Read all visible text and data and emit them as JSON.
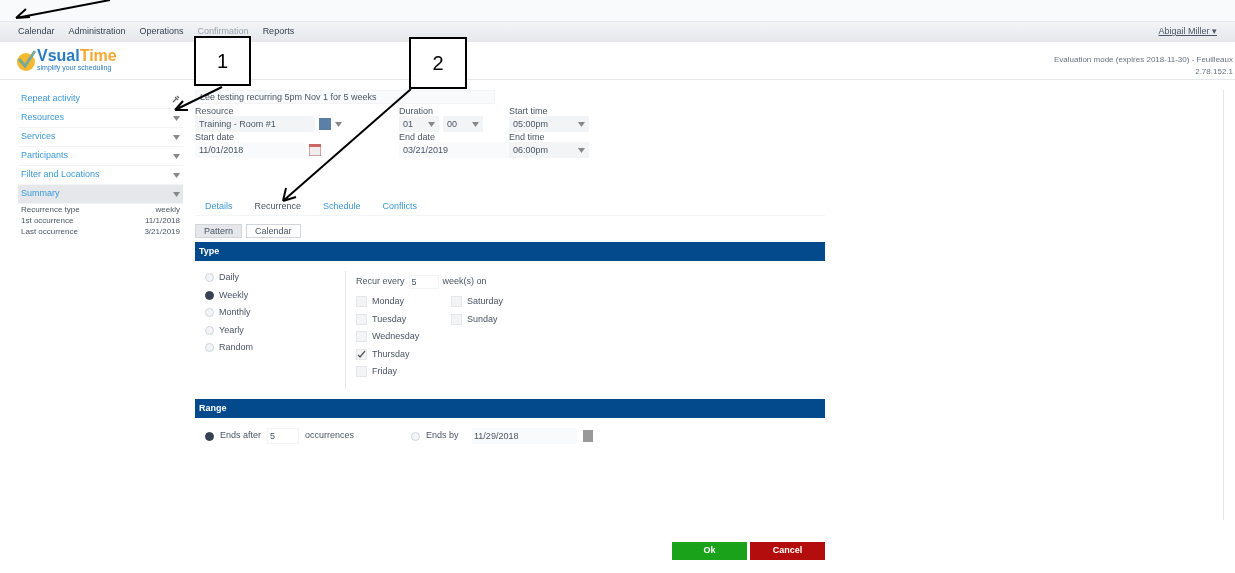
{
  "menu": [
    {
      "label": "Calendar",
      "disabled": false
    },
    {
      "label": "Administration",
      "disabled": false
    },
    {
      "label": "Operations",
      "disabled": false
    },
    {
      "label": "Confirmation",
      "disabled": true
    },
    {
      "label": "Reports",
      "disabled": false
    }
  ],
  "user": "Abigail Miller ▾",
  "logo": {
    "name_a": "V",
    "name_b": "sual",
    "name_c": "Time",
    "tagline": "simplify your scheduling"
  },
  "evaluation": "Evaluation mode (expires 2018-11-30) - Feuilleaux",
  "version": "2.78.152.1",
  "sidebar": {
    "items": [
      {
        "label": "Repeat activity",
        "kind": "pin",
        "selected": false
      },
      {
        "label": "Resources",
        "kind": "caret",
        "selected": false
      },
      {
        "label": "Services",
        "kind": "caret",
        "selected": false
      },
      {
        "label": "Participants",
        "kind": "caret",
        "selected": false
      },
      {
        "label": "Filter and Locations",
        "kind": "caret",
        "selected": false
      },
      {
        "label": "Summary",
        "kind": "caret",
        "selected": true
      }
    ],
    "summary": [
      {
        "label": "Recurrence type",
        "value": "weekly"
      },
      {
        "label": "1st occurrence",
        "value": "11/1/2018"
      },
      {
        "label": "Last occurrence",
        "value": "3/21/2019"
      }
    ]
  },
  "form": {
    "title": "Lee testing recurring 5pm Nov 1 for 5 weeks",
    "resource_label": "Resource",
    "resource": "Training - Room #1",
    "duration_label": "Duration",
    "hours": "01",
    "minutes": "00",
    "start_time_label": "Start time",
    "start_time": "05:00pm",
    "start_date_label": "Start date",
    "start_date": "11/01/2018",
    "end_date_label": "End date",
    "end_date": "03/21/2019",
    "end_time_label": "End time",
    "end_time": "06:00pm"
  },
  "tabs": [
    {
      "label": "Details",
      "selected": false
    },
    {
      "label": "Recurrence",
      "selected": true
    },
    {
      "label": "Schedule",
      "selected": false
    },
    {
      "label": "Conflicts",
      "selected": false
    }
  ],
  "subtabs": [
    {
      "label": "Pattern",
      "selected": true
    },
    {
      "label": "Calendar",
      "selected": false
    }
  ],
  "type_section": {
    "title": "Type",
    "options": [
      {
        "label": "Daily",
        "selected": false
      },
      {
        "label": "Weekly",
        "selected": true
      },
      {
        "label": "Monthly",
        "selected": false
      },
      {
        "label": "Yearly",
        "selected": false
      },
      {
        "label": "Random",
        "selected": false
      }
    ],
    "recur_label": "Recur every",
    "recur_value": "5",
    "recur_unit": "week(s) on",
    "days": [
      {
        "label": "Monday",
        "checked": false
      },
      {
        "label": "Tuesday",
        "checked": false
      },
      {
        "label": "Wednesday",
        "checked": false
      },
      {
        "label": "Thursday",
        "checked": true
      },
      {
        "label": "Friday",
        "checked": false
      },
      {
        "label": "Saturday",
        "checked": false
      },
      {
        "label": "Sunday",
        "checked": false
      }
    ]
  },
  "range_section": {
    "title": "Range",
    "ends_after_label": "Ends after",
    "ends_after_selected": true,
    "occurrences": "5",
    "occurrences_label": "occurrences",
    "ends_by_label": "Ends by",
    "ends_by_selected": false,
    "ends_by_date": "11/29/2018"
  },
  "buttons": [
    {
      "label": "Ok",
      "kind": "ok"
    },
    {
      "label": "Cancel",
      "kind": "cancel"
    }
  ],
  "callouts": [
    "1",
    "2"
  ]
}
